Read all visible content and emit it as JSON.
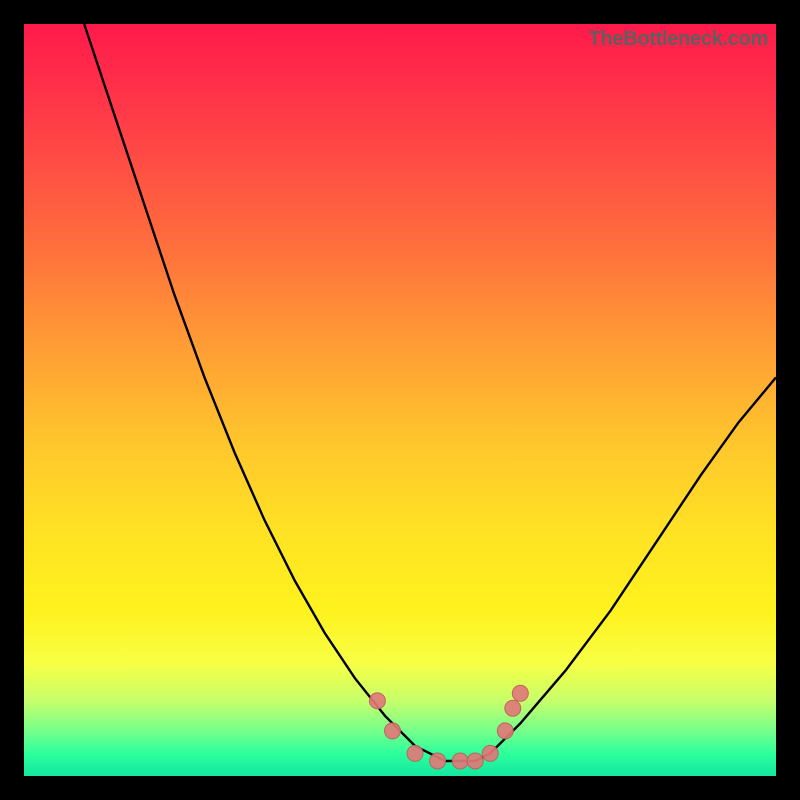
{
  "watermark": "TheBottleneck.com",
  "colors": {
    "frame": "#000000",
    "curve_stroke": "#000000",
    "marker_fill": "#e07a7a",
    "marker_stroke": "#c25a5a",
    "gradient_top": "#ff1a4b",
    "gradient_bottom": "#12e7a0"
  },
  "chart_data": {
    "type": "line",
    "title": "",
    "xlabel": "",
    "ylabel": "",
    "xlim": [
      0,
      100
    ],
    "ylim": [
      0,
      100
    ],
    "grid": false,
    "legend": false,
    "description": "V-shaped bottleneck curve over vertical rainbow gradient; minimum (green zone) between x≈52 and x≈62 at y≈2. Left branch starts near top-left (x≈8, y≈100) and descends steeply; right branch rises to about y≈53 at x≈100. Pink markers cluster around the flat minimum and on the inner slopes.",
    "series": [
      {
        "name": "bottleneck-curve",
        "x": [
          8,
          12,
          16,
          20,
          24,
          28,
          32,
          36,
          40,
          44,
          48,
          52,
          56,
          60,
          62,
          66,
          72,
          78,
          84,
          90,
          95,
          100
        ],
        "y": [
          100,
          88,
          76,
          64,
          53,
          43,
          34,
          26,
          19,
          13,
          8,
          4,
          2,
          2,
          3,
          7,
          14,
          22,
          31,
          40,
          47,
          53
        ]
      }
    ],
    "markers": [
      {
        "x": 47,
        "y": 10
      },
      {
        "x": 49,
        "y": 6
      },
      {
        "x": 52,
        "y": 3
      },
      {
        "x": 55,
        "y": 2
      },
      {
        "x": 58,
        "y": 2
      },
      {
        "x": 60,
        "y": 2
      },
      {
        "x": 62,
        "y": 3
      },
      {
        "x": 64,
        "y": 6
      },
      {
        "x": 65,
        "y": 9
      },
      {
        "x": 66,
        "y": 11
      }
    ]
  }
}
